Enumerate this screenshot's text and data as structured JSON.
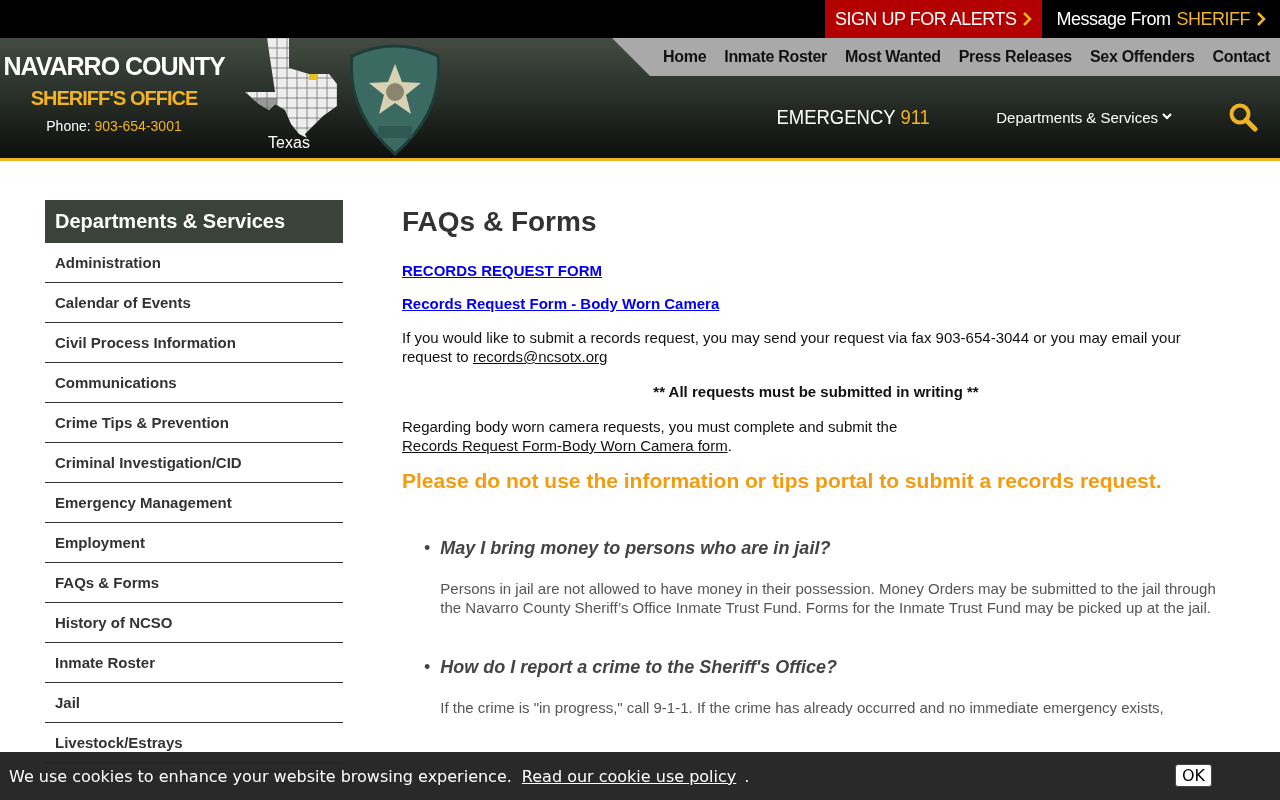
{
  "top_bar": {
    "alert_link": "SIGN UP FOR ALERTS",
    "message_link": {
      "prefix": "Message From",
      "highlight": "SHERIFF"
    }
  },
  "header": {
    "title": "NAVARRO COUNTY",
    "subtitle": "SHERIFF'S OFFICE",
    "phone_label": "Phone:",
    "phone": "903-654-3001",
    "map_label": "Texas",
    "emergency": {
      "label": "EMERGENCY",
      "number": "911"
    },
    "departments_menu": "Departments & Services"
  },
  "nav": [
    "Home",
    "Inmate Roster",
    "Most Wanted",
    "Press Releases",
    "Sex Offenders",
    "Contact"
  ],
  "sidebar": {
    "title": "Departments & Services",
    "items": [
      {
        "label": "Administration",
        "selected": false
      },
      {
        "label": "Calendar of Events",
        "selected": false
      },
      {
        "label": "Civil Process Information",
        "selected": false
      },
      {
        "label": "Communications",
        "selected": false
      },
      {
        "label": "Crime Tips & Prevention",
        "selected": false
      },
      {
        "label": "Criminal Investigation/CID",
        "selected": false
      },
      {
        "label": "Emergency Management",
        "selected": false
      },
      {
        "label": "Employment",
        "selected": false
      },
      {
        "label": "FAQs & Forms",
        "selected": false
      },
      {
        "label": "History of NCSO",
        "selected": false
      },
      {
        "label": "Inmate Roster",
        "selected": false
      },
      {
        "label": "Jail",
        "selected": false
      },
      {
        "label": "Livestock/Estrays",
        "selected": false
      }
    ]
  },
  "main": {
    "title": "FAQs & Forms",
    "form_links": [
      "RECORDS REQUEST FORM",
      "Records Request Form - Body Worn Camera"
    ],
    "intro": {
      "text": "If you would like to submit a records request, you may send your request via fax 903-654-3044 or you may email your request to ",
      "email": "records@ncsotx.org"
    },
    "notice": "** All requests must be submitted in writing **",
    "bodycam": {
      "text": "Regarding body worn camera requests, you must complete and submit the ",
      "link": "Records Request Form-Body Worn Camera form",
      "end": "."
    },
    "warning": "Please do not use the information or tips portal to submit a records request.",
    "faqs": [
      {
        "marker": "•",
        "question": "May I bring money to persons who are in jail?",
        "answer": "Persons in jail are not allowed to have money in their possession. Money Orders may be submitted to the jail through the Navarro County Sheriff’s Office Inmate Trust Fund. Forms for the Inmate Trust Fund may be picked up at the jail."
      },
      {
        "marker": "•",
        "question": "How do I report a crime to the Sheriff's Office?",
        "answer": "If the crime is \"in progress,\" call 9-1-1. If the crime has already occurred and no immediate emergency exists,"
      }
    ]
  },
  "cookie_bar": {
    "text": "We use cookies to enhance your website browsing experience.",
    "link": "Read our cookie use policy",
    "end": ".",
    "button": "OK"
  }
}
